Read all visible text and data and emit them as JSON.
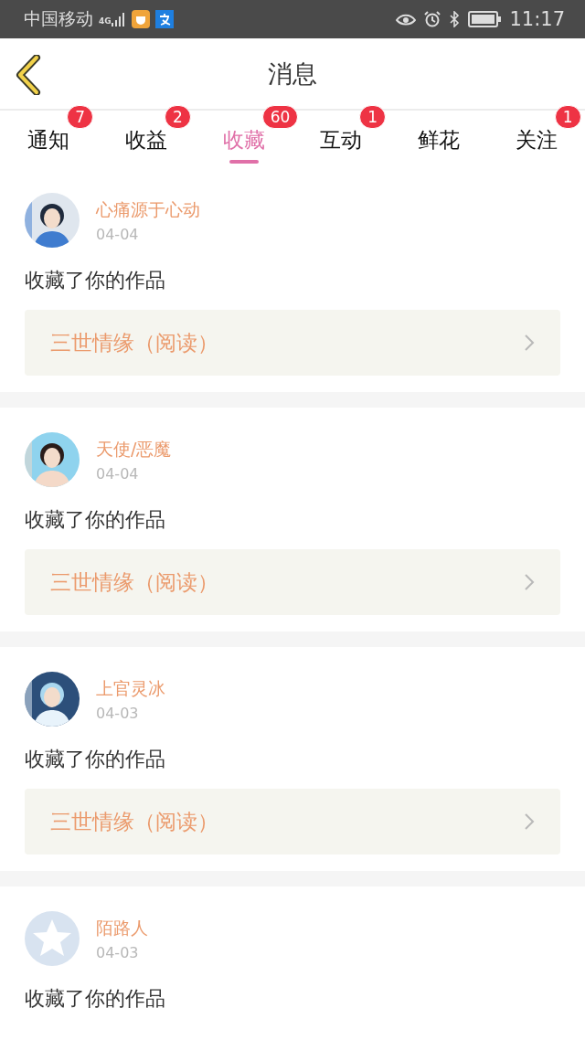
{
  "status_bar": {
    "carrier": "中国移动",
    "network": "4G",
    "time": "11:17"
  },
  "header": {
    "title": "消息"
  },
  "tabs": [
    {
      "label": "通知",
      "badge": "7",
      "selected": false
    },
    {
      "label": "收益",
      "badge": "2",
      "selected": false
    },
    {
      "label": "收藏",
      "badge": "60",
      "selected": true
    },
    {
      "label": "互动",
      "badge": "1",
      "selected": false
    },
    {
      "label": "鲜花",
      "selected": false
    },
    {
      "label": "关注",
      "badge": "1",
      "selected": false
    }
  ],
  "items": [
    {
      "name": "心痛源于心动",
      "date": "04-04",
      "text": "收藏了你的作品",
      "work": "三世情缘（阅读）"
    },
    {
      "name": "天使/恶魔",
      "date": "04-04",
      "text": "收藏了你的作品",
      "work": "三世情缘（阅读）"
    },
    {
      "name": "上官灵冰",
      "date": "04-03",
      "text": "收藏了你的作品",
      "work": "三世情缘（阅读）"
    },
    {
      "avatar": {
        "kind": "default"
      },
      "name": "陌路人",
      "date": "04-03",
      "text": "收藏了你的作品"
    }
  ]
}
